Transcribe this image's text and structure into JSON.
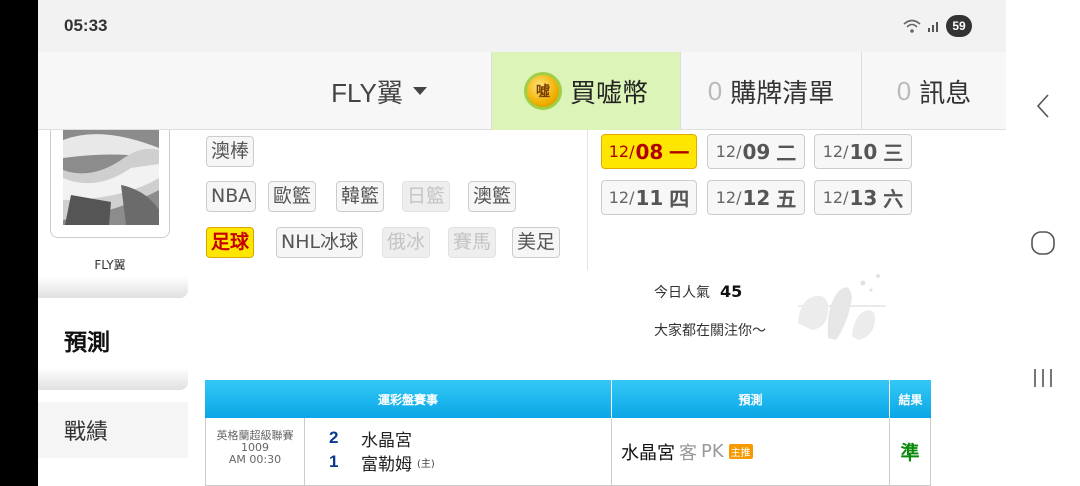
{
  "status": {
    "time": "05:33",
    "battery": "59"
  },
  "topnav": {
    "user_name": "FLY翼",
    "buy_label": "買嘘幣",
    "coin_glyph": "噓",
    "cart_count": "0",
    "cart_label": "購牌清單",
    "msg_count": "0",
    "msg_label": "訊息"
  },
  "sidebar": {
    "avatar_name": "FLY翼",
    "predict_label": "預測",
    "record_label": "戰績"
  },
  "sports": {
    "row1": [
      {
        "label": "澳棒",
        "state": "normal"
      }
    ],
    "row2": [
      {
        "label": "NBA",
        "state": "normal"
      },
      {
        "label": "歐籃",
        "state": "normal"
      },
      {
        "label": "韓籃",
        "state": "normal"
      },
      {
        "label": "日籃",
        "state": "disabled"
      },
      {
        "label": "澳籃",
        "state": "normal"
      }
    ],
    "row3": [
      {
        "label": "足球",
        "state": "selected"
      },
      {
        "label": "NHL冰球",
        "state": "normal"
      },
      {
        "label": "俄冰",
        "state": "disabled"
      },
      {
        "label": "賽馬",
        "state": "disabled"
      },
      {
        "label": "美足",
        "state": "normal"
      }
    ]
  },
  "dates": [
    {
      "md": "12/",
      "d": "08",
      "wd": "一",
      "selected": true
    },
    {
      "md": "12/",
      "d": "09",
      "wd": "二",
      "selected": false
    },
    {
      "md": "12/",
      "d": "10",
      "wd": "三",
      "selected": false
    },
    {
      "md": "12/",
      "d": "11",
      "wd": "四",
      "selected": false
    },
    {
      "md": "12/",
      "d": "12",
      "wd": "五",
      "selected": false
    },
    {
      "md": "12/",
      "d": "13",
      "wd": "六",
      "selected": false
    }
  ],
  "popularity": {
    "label": "今日人氣",
    "value": "45",
    "follow_text": "大家都在關注你～"
  },
  "table": {
    "headers": {
      "event": "運彩盤賽事",
      "prediction": "預測",
      "result": "結果"
    },
    "row": {
      "league": "英格蘭超級聯賽",
      "code": "1009",
      "time": "AM 00:30",
      "team1_score": "2",
      "team1": "水晶宮",
      "team2_score": "1",
      "team2": "富勒姆",
      "home_tag": "(主)",
      "pick_team": "水晶宮",
      "pick_side": "客",
      "pick_type": "PK",
      "pick_tag": "主推",
      "result": "準"
    }
  },
  "colors": {
    "accent_yellow": "#ffe600",
    "header_blue": "#0aa6e6",
    "buy_green": "#ddf4b9",
    "win_green": "#0a8a0a"
  }
}
